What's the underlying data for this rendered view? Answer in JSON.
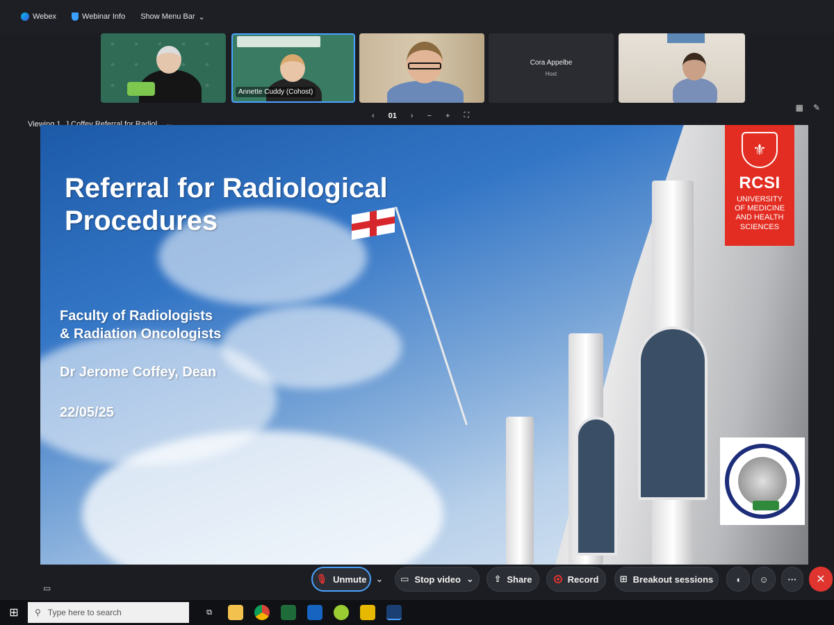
{
  "topbar": {
    "app_name": "Webex",
    "webinar_info": "Webinar Info",
    "show_menu_bar": "Show Menu Bar"
  },
  "participants": [
    {
      "label": ""
    },
    {
      "label": "Annette  Cuddy (Cohost)"
    },
    {
      "label": ""
    },
    {
      "name": "Cora Appelbe",
      "role": "Host"
    },
    {
      "label": ""
    }
  ],
  "viewbar": {
    "viewing": "Viewing 1. J Coffey Referral for Radiol...",
    "page": "01"
  },
  "slide": {
    "title": "Referral for Radiological Procedures",
    "faculty_line1": "Faculty of Radiologists",
    "faculty_line2": "& Radiation Oncologists",
    "presenter": "Dr Jerome Coffey, Dean",
    "date": "22/05/25",
    "rcsi": {
      "acronym": "RCSI",
      "line1": "UNIVERSITY",
      "line2": "OF MEDICINE",
      "line3": "AND HEALTH",
      "line4": "SCIENCES"
    }
  },
  "controls": {
    "unmute": "Unmute",
    "stop_video": "Stop video",
    "share": "Share",
    "record": "Record",
    "breakout": "Breakout sessions",
    "more": "···"
  },
  "taskbar": {
    "search_placeholder": "Type here to search"
  }
}
